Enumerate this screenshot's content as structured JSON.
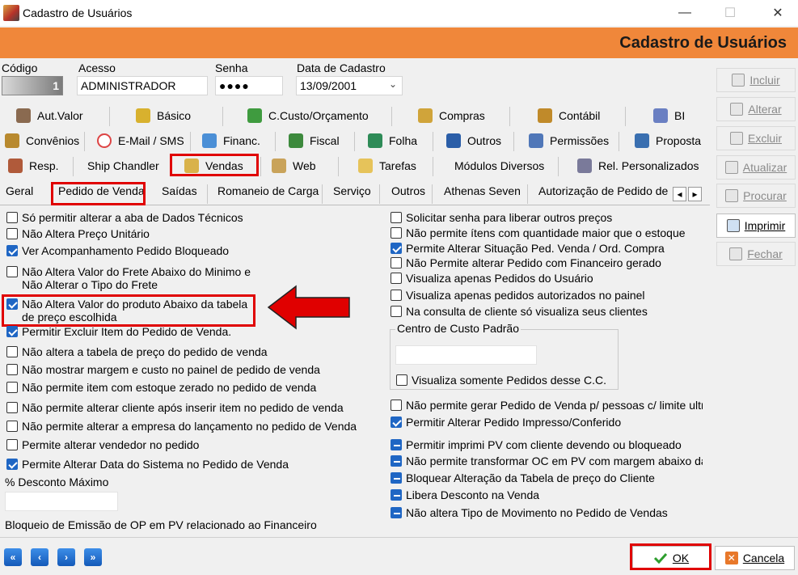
{
  "window": {
    "title": "Cadastro de Usuários",
    "heading": "Cadastro de Usuários",
    "minimize": "—",
    "maximize": "☐",
    "close": "✕"
  },
  "fields": {
    "codigo": {
      "label": "Código",
      "value": "1"
    },
    "acesso": {
      "label": "Acesso",
      "value": "ADMINISTRADOR"
    },
    "senha": {
      "label": "Senha",
      "value": "●●●●"
    },
    "data_cadastro": {
      "label": "Data de Cadastro",
      "value": "13/09/2001"
    }
  },
  "tabs_row1": [
    "Aut.Valor",
    "Básico",
    "C.Custo/Orçamento",
    "Compras",
    "Contábil",
    "BI"
  ],
  "tabs_row2": [
    "Convênios",
    "E-Mail / SMS",
    "Financ.",
    "Fiscal",
    "Folha",
    "Outros",
    "Permissões",
    "Proposta"
  ],
  "tabs_row3": [
    "Resp.",
    "Ship Chandler",
    "Vendas",
    "Web",
    "Tarefas",
    "Módulos Diversos",
    "Rel. Personalizados"
  ],
  "subtabs": [
    "Geral",
    "Pedido de Venda",
    "Saídas",
    "Romaneio de Carga",
    "Serviço",
    "Outros",
    "Athenas Seven",
    "Autorização de Pedido de V"
  ],
  "left_options": [
    {
      "label": "Só permitir alterar a aba de Dados Técnicos",
      "state": "off"
    },
    {
      "label": "Não Altera Preço Unitário",
      "state": "off"
    },
    {
      "label": "Ver Acompanhamento Pedido Bloqueado",
      "state": "on"
    },
    {
      "label": "Não Altera Valor do Frete Abaixo do Minimo e Não Alterar o Tipo do Frete",
      "state": "off"
    },
    {
      "label": "Não Altera Valor do produto Abaixo da tabela de preço escolhida",
      "state": "on"
    },
    {
      "label": "Permitir Excluir Item do Pedido de Venda.",
      "state": "on"
    },
    {
      "label": "Não altera a tabela de preço do pedido de venda",
      "state": "off"
    },
    {
      "label": "Não mostrar margem e custo no painel de pedido de venda",
      "state": "off"
    },
    {
      "label": "Não permite item com estoque zerado no pedido de venda",
      "state": "off"
    },
    {
      "label": "Não permite alterar cliente após inserir item no pedido de venda",
      "state": "off"
    },
    {
      "label": "Não permite alterar a empresa do lançamento no pedido de Venda",
      "state": "off"
    },
    {
      "label": "Permite alterar vendedor no pedido",
      "state": "off"
    },
    {
      "label": "Permite Alterar Data do Sistema no Pedido de Venda",
      "state": "on"
    }
  ],
  "desconto_label": "% Desconto Máximo",
  "desconto_value": "",
  "bloqueio_label": "Bloqueio de Emissão de OP em PV relacionado ao Financeiro",
  "right_options_a": [
    {
      "label": "Solicitar senha para liberar outros preços",
      "state": "off"
    },
    {
      "label": "Não permite ítens com quantidade maior que o estoque",
      "state": "off"
    },
    {
      "label": "Permite Alterar Situação Ped. Venda / Ord. Compra",
      "state": "on"
    },
    {
      "label": "Não Permite alterar Pedido com Financeiro gerado",
      "state": "off"
    },
    {
      "label": "Visualiza apenas Pedidos do Usuário",
      "state": "off"
    },
    {
      "label": "Visualiza apenas pedidos autorizados no painel",
      "state": "off"
    },
    {
      "label": "Na consulta de cliente só visualiza seus clientes",
      "state": "off"
    }
  ],
  "centro_custo": {
    "legend": "Centro de Custo Padrão",
    "value": "",
    "option": "Visualiza somente Pedidos desse C.C."
  },
  "right_options_b": [
    {
      "label": "Não permite gerar Pedido de Venda p/ pessoas c/ limite ultrapa",
      "state": "off"
    },
    {
      "label": "Permitir Alterar Pedido Impresso/Conferido",
      "state": "on"
    }
  ],
  "right_options_c": [
    {
      "label": "Permitir imprimi PV com cliente devendo ou bloqueado",
      "state": "ind"
    },
    {
      "label": "Não permite transformar OC em PV com margem abaixo da idea",
      "state": "ind"
    },
    {
      "label": "Bloquear Alteração da Tabela de preço do Cliente",
      "state": "ind"
    },
    {
      "label": "Libera Desconto na Venda",
      "state": "ind"
    },
    {
      "label": "Não altera Tipo de Movimento no Pedido de Vendas",
      "state": "ind"
    }
  ],
  "side_buttons": [
    {
      "label": "Incluir",
      "active": false,
      "icon": "page-icon"
    },
    {
      "label": "Alterar",
      "active": false,
      "icon": "edit-icon"
    },
    {
      "label": "Excluir",
      "active": false,
      "icon": "trash-icon"
    },
    {
      "label": "Atualizar",
      "active": false,
      "icon": "refresh-icon"
    },
    {
      "label": "Procurar",
      "active": false,
      "icon": "binoculars-icon"
    },
    {
      "label": "Imprimir",
      "active": true,
      "icon": "printer-icon"
    },
    {
      "label": "Fechar",
      "active": false,
      "icon": "exit-icon"
    }
  ],
  "nav": {
    "first": "«",
    "prev": "‹",
    "next": "›",
    "last": "»"
  },
  "bottom": {
    "ok": "OK",
    "cancel": "Cancela"
  },
  "scroll": {
    "left": "◂",
    "right": "▸"
  },
  "colors": {
    "accent": "#f0873a",
    "highlight": "#e00000",
    "check": "#1f66c4"
  }
}
